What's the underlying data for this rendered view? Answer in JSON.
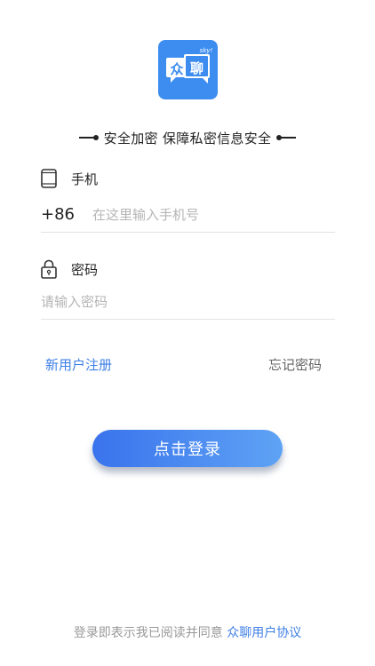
{
  "logo": {
    "main_text": "众",
    "bubble_text": "聊",
    "tag_text": "sky!",
    "color": "#3d8df0"
  },
  "slogan": "安全加密 保障私密信息安全",
  "phone": {
    "label": "手机",
    "icon": "phone-icon",
    "country_code": "+86",
    "placeholder": "在这里输入手机号",
    "value": ""
  },
  "password": {
    "label": "密码",
    "icon": "lock-icon",
    "placeholder": "请输入密码",
    "value": ""
  },
  "links": {
    "register": "新用户注册",
    "forgot": "忘记密码"
  },
  "login_button": "点击登录",
  "agreement": {
    "prefix": "登录即表示我已阅读并同意",
    "protocol": "众聊用户协议"
  },
  "colors": {
    "accent": "#3d7fe6",
    "button_start": "#3a73ec",
    "button_end": "#5ea3f5"
  }
}
